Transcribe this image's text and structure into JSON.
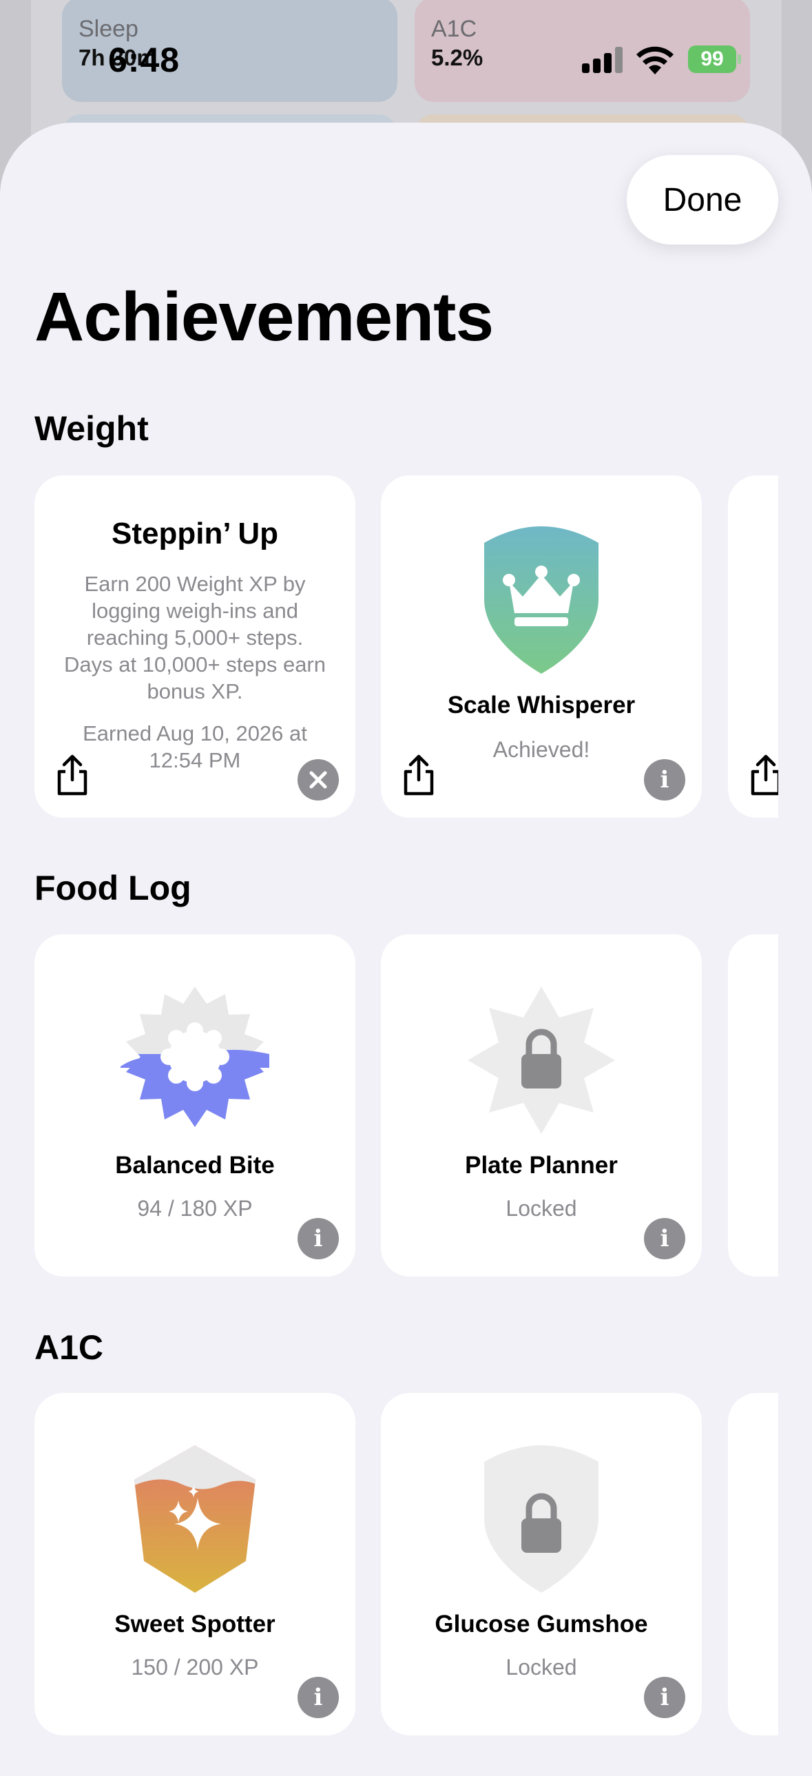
{
  "status_bar": {
    "time": "6:48",
    "battery": "99"
  },
  "background_app": {
    "tiles": [
      {
        "label": "Sleep",
        "value": "7h 30m"
      },
      {
        "label": "A1C",
        "value": "5.2%"
      }
    ]
  },
  "sheet": {
    "done_label": "Done",
    "title": "Achievements"
  },
  "sections": {
    "weight": {
      "title": "Weight",
      "cards": {
        "steppin": {
          "title": "Steppin’ Up",
          "description": "Earn 200 Weight XP by logging weigh-ins and reaching 5,000+ steps. Days at 10,000+ steps earn bonus XP.",
          "earned": "Earned Aug 10, 2026 at 12:54 PM"
        },
        "scale": {
          "title": "Scale Whisperer",
          "status": "Achieved!"
        }
      }
    },
    "food": {
      "title": "Food Log",
      "cards": {
        "balanced": {
          "title": "Balanced Bite",
          "status": "94 / 180 XP",
          "progress_fraction": 0.52
        },
        "plate": {
          "title": "Plate Planner",
          "status": "Locked"
        }
      }
    },
    "a1c": {
      "title": "A1C",
      "cards": {
        "sweet": {
          "title": "Sweet Spotter",
          "status": "150 / 200 XP",
          "progress_fraction": 0.75
        },
        "glucose": {
          "title": "Glucose Gumshoe",
          "status": "Locked"
        }
      }
    }
  },
  "icons": {
    "share": "share-icon",
    "info": "info-icon",
    "close": "close-icon",
    "lock": "lock-icon",
    "crown": "crown-icon",
    "sparkles": "sparkles-icon"
  },
  "colors": {
    "sheet_background": "#f2f1f7",
    "shield_gradient": [
      "#6fb8c6",
      "#7cc98a"
    ],
    "food_badge_fill": "#7b86f2",
    "a1c_badge_gradient": [
      "#e07a68",
      "#d9b340"
    ],
    "locked_badge": "#ececec",
    "battery": "#65c466"
  }
}
